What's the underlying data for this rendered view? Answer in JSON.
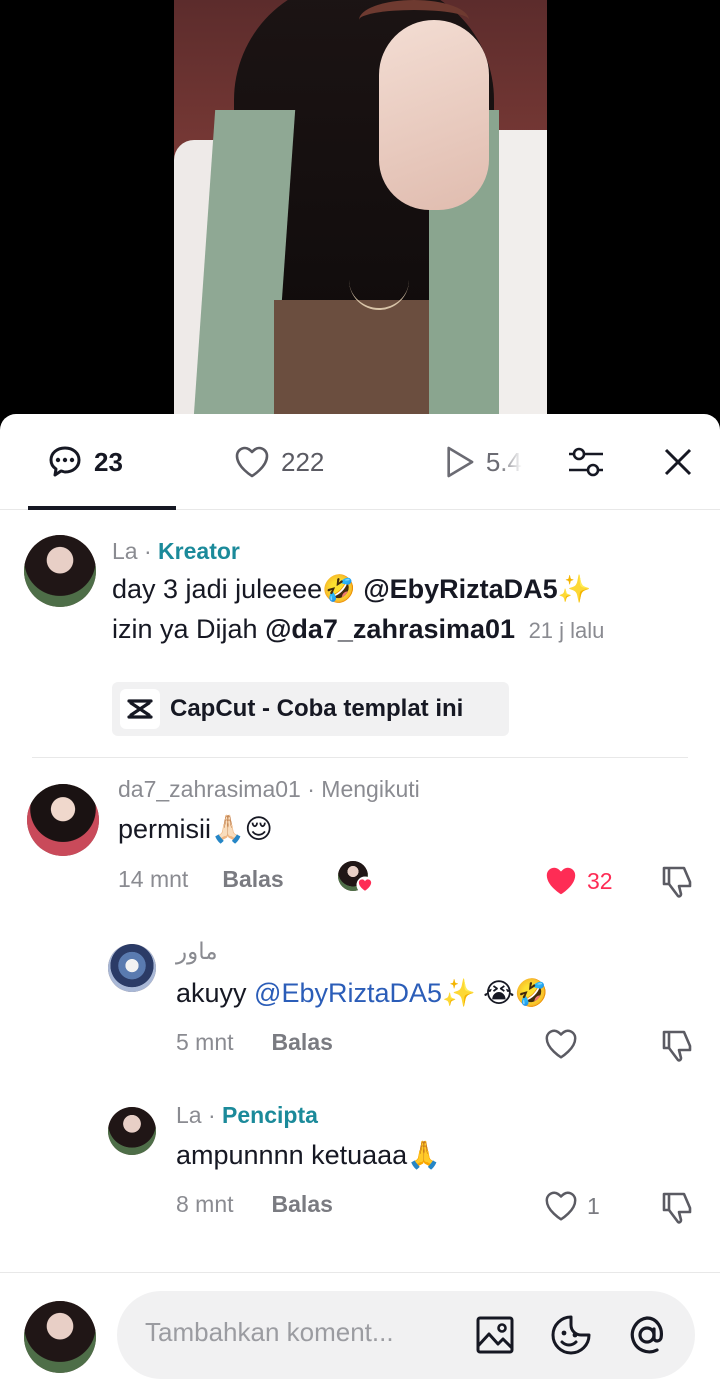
{
  "tabs": {
    "comments_count": "23",
    "likes_count": "222",
    "plays_count": "5.4"
  },
  "comments": [
    {
      "user": "La",
      "sep": " · ",
      "tag": "Kreator",
      "line1_text": "day 3 jadi juleeee",
      "line1_emoji": "🤣",
      "line1_mention": "@EbyRiztaDA5",
      "line1_sparkle": "✨",
      "line2_text": "izin ya Dijah ",
      "line2_mention": "@da7_zahrasima01",
      "time": "21 j lalu",
      "capcut_label": "CapCut - Coba templat ini"
    },
    {
      "user": "da7_zahrasima01",
      "sep": " · ",
      "tag": "Mengikuti",
      "text": "permisii🙏🏻😌",
      "time": "14 mnt",
      "reply_label": "Balas",
      "likes": "32"
    },
    {
      "user": "ماور",
      "text_prefix": "akuyy ",
      "mention": "@EbyRiztaDA5",
      "text_suffix": "✨ 😭🤣",
      "time": "5 mnt",
      "reply_label": "Balas"
    },
    {
      "user": "La",
      "sep": " · ",
      "tag": "Pencipta",
      "text": "ampunnnn ketuaaa🙏",
      "time": "8 mnt",
      "reply_label": "Balas",
      "likes": "1"
    }
  ],
  "composer": {
    "placeholder": "Tambahkan koment..."
  },
  "colors": {
    "accent_teal": "#1b8a9a",
    "like_red": "#fe2c55",
    "mention_blue": "#2b5db8"
  },
  "icons": [
    "comment-icon",
    "heart-icon",
    "play-icon",
    "filter-icon",
    "close-icon",
    "capcut-icon",
    "dislike-icon",
    "image-icon",
    "emoji-icon",
    "at-icon"
  ]
}
